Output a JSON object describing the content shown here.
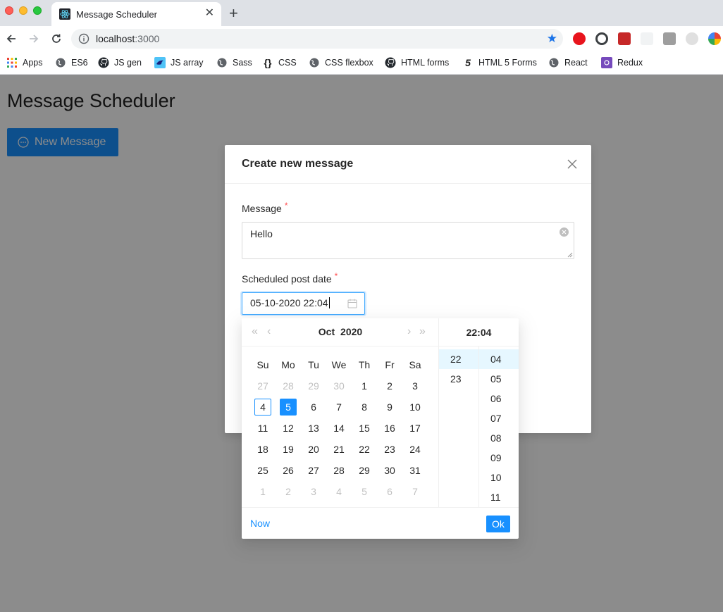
{
  "browser": {
    "tab_title": "Message Scheduler",
    "tab_close": "✕",
    "new_tab": "+",
    "url_host": "localhost",
    "url_port": ":3000",
    "star": "★",
    "bookmarks": [
      {
        "label": "Apps",
        "icon": "apps-grid-icon"
      },
      {
        "label": "ES6",
        "icon": "globe-icon"
      },
      {
        "label": "JS gen",
        "icon": "github-icon"
      },
      {
        "label": "JS array",
        "icon": "bird-icon"
      },
      {
        "label": "Sass",
        "icon": "globe-icon"
      },
      {
        "label": "CSS",
        "icon": "braces-icon"
      },
      {
        "label": "CSS flexbox",
        "icon": "globe-icon"
      },
      {
        "label": "HTML forms",
        "icon": "github-icon"
      },
      {
        "label": "HTML 5 Forms",
        "icon": "html5-icon"
      },
      {
        "label": "React",
        "icon": "globe-icon"
      },
      {
        "label": "Redux",
        "icon": "redux-icon"
      }
    ]
  },
  "page": {
    "title": "Message Scheduler",
    "new_message_button": "New Message"
  },
  "modal": {
    "title": "Create new message",
    "message_label": "Message",
    "required_mark": "*",
    "message_value": "Hello",
    "date_label": "Scheduled post date",
    "date_value": "05-10-2020 22:04"
  },
  "picker": {
    "super_prev": "«",
    "prev": "‹",
    "next": "›",
    "super_next": "»",
    "month": "Oct",
    "year": "2020",
    "weekdays": [
      "Su",
      "Mo",
      "Tu",
      "We",
      "Th",
      "Fr",
      "Sa"
    ],
    "weeks": [
      [
        {
          "d": "27",
          "o": true
        },
        {
          "d": "28",
          "o": true
        },
        {
          "d": "29",
          "o": true
        },
        {
          "d": "30",
          "o": true
        },
        {
          "d": "1"
        },
        {
          "d": "2"
        },
        {
          "d": "3"
        }
      ],
      [
        {
          "d": "4",
          "today": true
        },
        {
          "d": "5",
          "sel": true
        },
        {
          "d": "6"
        },
        {
          "d": "7"
        },
        {
          "d": "8"
        },
        {
          "d": "9"
        },
        {
          "d": "10"
        }
      ],
      [
        {
          "d": "11"
        },
        {
          "d": "12"
        },
        {
          "d": "13"
        },
        {
          "d": "14"
        },
        {
          "d": "15"
        },
        {
          "d": "16"
        },
        {
          "d": "17"
        }
      ],
      [
        {
          "d": "18"
        },
        {
          "d": "19"
        },
        {
          "d": "20"
        },
        {
          "d": "21"
        },
        {
          "d": "22"
        },
        {
          "d": "23"
        },
        {
          "d": "24"
        }
      ],
      [
        {
          "d": "25"
        },
        {
          "d": "26"
        },
        {
          "d": "27"
        },
        {
          "d": "28"
        },
        {
          "d": "29"
        },
        {
          "d": "30"
        },
        {
          "d": "31"
        }
      ],
      [
        {
          "d": "1",
          "o": true
        },
        {
          "d": "2",
          "o": true
        },
        {
          "d": "3",
          "o": true
        },
        {
          "d": "4",
          "o": true
        },
        {
          "d": "5",
          "o": true
        },
        {
          "d": "6",
          "o": true
        },
        {
          "d": "7",
          "o": true
        }
      ]
    ],
    "time_header": "22:04",
    "hours": [
      "22",
      "23"
    ],
    "selected_hour": "22",
    "minutes": [
      "04",
      "05",
      "06",
      "07",
      "08",
      "09",
      "10",
      "11"
    ],
    "selected_minute": "04",
    "now_label": "Now",
    "ok_label": "Ok"
  },
  "colors": {
    "primary": "#1890ff",
    "required": "#ff4d4f",
    "mask": "rgba(0,0,0,0.45)"
  }
}
